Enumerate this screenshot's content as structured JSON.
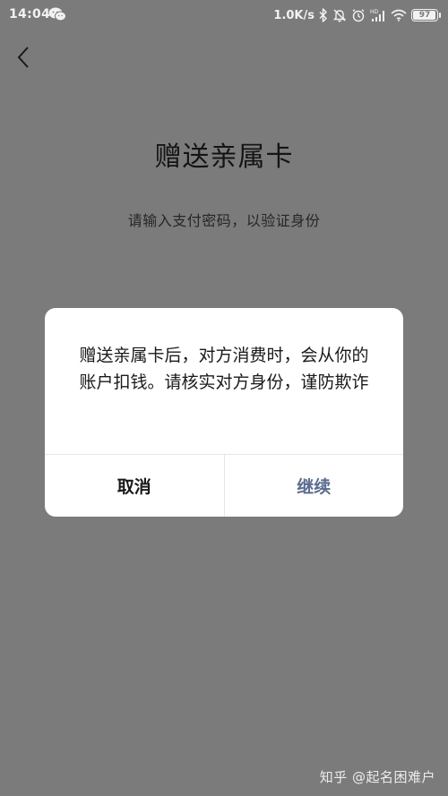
{
  "status_bar": {
    "time": "14:04",
    "net_speed": "1.0K/s",
    "battery_level": "97",
    "battery_fraction": 0.97
  },
  "icons": {
    "wechat": "wechat-icon",
    "bluetooth": "bluetooth-icon",
    "mute": "bell-off-icon",
    "alarm": "alarm-icon",
    "signal": "signal-icon",
    "wifi": "wifi-icon",
    "battery": "battery-icon",
    "back": "chevron-left-icon"
  },
  "page": {
    "title": "赠送亲属卡",
    "subtitle": "请输入支付密码，以验证身份"
  },
  "dialog": {
    "message": "赠送亲属卡后，对方消费时，会从你的账户扣钱。请核实对方身份，谨防欺诈",
    "cancel_label": "取消",
    "continue_label": "继续"
  },
  "watermark": "知乎 @起名困难户",
  "colors": {
    "overlay_background": "#7b7b7b",
    "dialog_background": "#ffffff",
    "continue_accent": "#5b6c8f"
  }
}
